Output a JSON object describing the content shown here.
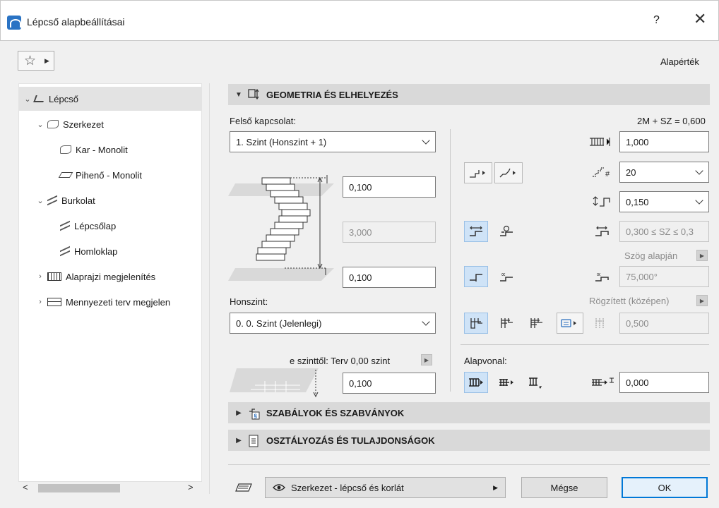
{
  "window": {
    "title": "Lépcső alapbeállításai",
    "help": "?",
    "close": "✕"
  },
  "toolbar": {
    "favorites_icon": "star-icon",
    "default_label": "Alapérték"
  },
  "tree": {
    "items": [
      {
        "label": "Lépcső",
        "chevron": "⌄",
        "icon": "stair-icon"
      },
      {
        "label": "Szerkezet",
        "chevron": "⌄",
        "icon": "structure-icon"
      },
      {
        "label": "Kar - Monolit",
        "chevron": "",
        "icon": "flight-icon"
      },
      {
        "label": "Pihenő - Monolit",
        "chevron": "",
        "icon": "landing-icon"
      },
      {
        "label": "Burkolat",
        "chevron": "⌄",
        "icon": "finish-icon"
      },
      {
        "label": "Lépcsőlap",
        "chevron": "",
        "icon": "tread-icon"
      },
      {
        "label": "Homloklap",
        "chevron": "",
        "icon": "riser-icon"
      },
      {
        "label": "Alaprajzi megjelenítés",
        "chevron": "›",
        "icon": "floorplan-icon"
      },
      {
        "label": "Mennyezeti terv megjelen",
        "chevron": "›",
        "icon": "ceiling-icon"
      }
    ],
    "scroll_left": "<",
    "scroll_right": ">"
  },
  "geometry": {
    "header": "GEOMETRIA ÉS ELHELYEZÉS",
    "top_link_label": "Felső kapcsolat:",
    "top_link_value": "1. Szint (Honszint + 1)",
    "top_offset": "0,100",
    "total_height": "3,000",
    "bottom_offset": "0,100",
    "home_story_label": "Honszint:",
    "home_story_value": "0. 0. Szint (Jelenlegi)",
    "from_story_label": "e szinttől: Terv 0,00 szint",
    "from_story_value": "0,100",
    "rule_label": "2M + SZ = 0,600",
    "width": "1,000",
    "riser_count": "20",
    "riser_height": "0,150",
    "tread_depth": "0,300 ≤ SZ ≤ 0,3",
    "angle_label": "Szög alapján",
    "angle_value": "75,000°",
    "fixed_label": "Rögzített (középen)",
    "fixed_value": "0,500",
    "baseline_label": "Alapvonal:",
    "baseline_offset": "0,000"
  },
  "sections": {
    "rules": "SZABÁLYOK ÉS SZABVÁNYOK",
    "classification": "OSZTÁLYOZÁS ÉS TULAJDONSÁGOK"
  },
  "footer": {
    "layer_value": "Szerkezet - lépcső és korlát",
    "cancel": "Mégse",
    "ok": "OK"
  }
}
